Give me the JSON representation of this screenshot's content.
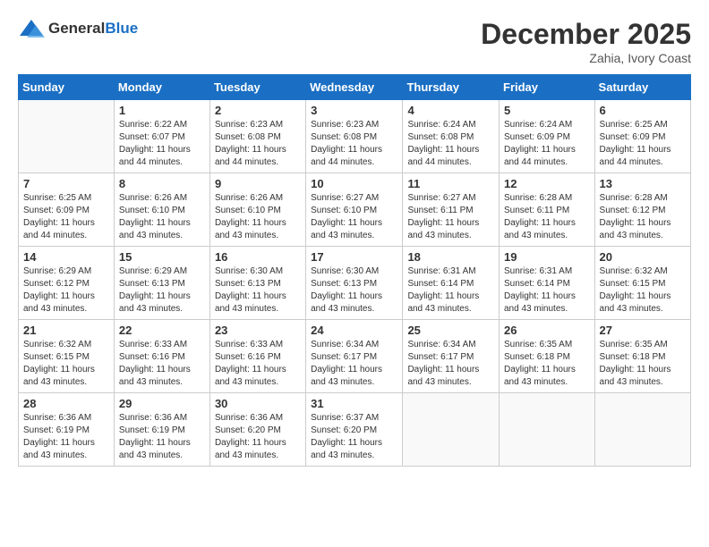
{
  "header": {
    "logo_general": "General",
    "logo_blue": "Blue",
    "month": "December 2025",
    "location": "Zahia, Ivory Coast"
  },
  "days_of_week": [
    "Sunday",
    "Monday",
    "Tuesday",
    "Wednesday",
    "Thursday",
    "Friday",
    "Saturday"
  ],
  "weeks": [
    [
      {
        "day": "",
        "sunrise": "",
        "sunset": "",
        "daylight": ""
      },
      {
        "day": "1",
        "sunrise": "Sunrise: 6:22 AM",
        "sunset": "Sunset: 6:07 PM",
        "daylight": "Daylight: 11 hours and 44 minutes."
      },
      {
        "day": "2",
        "sunrise": "Sunrise: 6:23 AM",
        "sunset": "Sunset: 6:08 PM",
        "daylight": "Daylight: 11 hours and 44 minutes."
      },
      {
        "day": "3",
        "sunrise": "Sunrise: 6:23 AM",
        "sunset": "Sunset: 6:08 PM",
        "daylight": "Daylight: 11 hours and 44 minutes."
      },
      {
        "day": "4",
        "sunrise": "Sunrise: 6:24 AM",
        "sunset": "Sunset: 6:08 PM",
        "daylight": "Daylight: 11 hours and 44 minutes."
      },
      {
        "day": "5",
        "sunrise": "Sunrise: 6:24 AM",
        "sunset": "Sunset: 6:09 PM",
        "daylight": "Daylight: 11 hours and 44 minutes."
      },
      {
        "day": "6",
        "sunrise": "Sunrise: 6:25 AM",
        "sunset": "Sunset: 6:09 PM",
        "daylight": "Daylight: 11 hours and 44 minutes."
      }
    ],
    [
      {
        "day": "7",
        "sunrise": "Sunrise: 6:25 AM",
        "sunset": "Sunset: 6:09 PM",
        "daylight": "Daylight: 11 hours and 44 minutes."
      },
      {
        "day": "8",
        "sunrise": "Sunrise: 6:26 AM",
        "sunset": "Sunset: 6:10 PM",
        "daylight": "Daylight: 11 hours and 43 minutes."
      },
      {
        "day": "9",
        "sunrise": "Sunrise: 6:26 AM",
        "sunset": "Sunset: 6:10 PM",
        "daylight": "Daylight: 11 hours and 43 minutes."
      },
      {
        "day": "10",
        "sunrise": "Sunrise: 6:27 AM",
        "sunset": "Sunset: 6:10 PM",
        "daylight": "Daylight: 11 hours and 43 minutes."
      },
      {
        "day": "11",
        "sunrise": "Sunrise: 6:27 AM",
        "sunset": "Sunset: 6:11 PM",
        "daylight": "Daylight: 11 hours and 43 minutes."
      },
      {
        "day": "12",
        "sunrise": "Sunrise: 6:28 AM",
        "sunset": "Sunset: 6:11 PM",
        "daylight": "Daylight: 11 hours and 43 minutes."
      },
      {
        "day": "13",
        "sunrise": "Sunrise: 6:28 AM",
        "sunset": "Sunset: 6:12 PM",
        "daylight": "Daylight: 11 hours and 43 minutes."
      }
    ],
    [
      {
        "day": "14",
        "sunrise": "Sunrise: 6:29 AM",
        "sunset": "Sunset: 6:12 PM",
        "daylight": "Daylight: 11 hours and 43 minutes."
      },
      {
        "day": "15",
        "sunrise": "Sunrise: 6:29 AM",
        "sunset": "Sunset: 6:13 PM",
        "daylight": "Daylight: 11 hours and 43 minutes."
      },
      {
        "day": "16",
        "sunrise": "Sunrise: 6:30 AM",
        "sunset": "Sunset: 6:13 PM",
        "daylight": "Daylight: 11 hours and 43 minutes."
      },
      {
        "day": "17",
        "sunrise": "Sunrise: 6:30 AM",
        "sunset": "Sunset: 6:13 PM",
        "daylight": "Daylight: 11 hours and 43 minutes."
      },
      {
        "day": "18",
        "sunrise": "Sunrise: 6:31 AM",
        "sunset": "Sunset: 6:14 PM",
        "daylight": "Daylight: 11 hours and 43 minutes."
      },
      {
        "day": "19",
        "sunrise": "Sunrise: 6:31 AM",
        "sunset": "Sunset: 6:14 PM",
        "daylight": "Daylight: 11 hours and 43 minutes."
      },
      {
        "day": "20",
        "sunrise": "Sunrise: 6:32 AM",
        "sunset": "Sunset: 6:15 PM",
        "daylight": "Daylight: 11 hours and 43 minutes."
      }
    ],
    [
      {
        "day": "21",
        "sunrise": "Sunrise: 6:32 AM",
        "sunset": "Sunset: 6:15 PM",
        "daylight": "Daylight: 11 hours and 43 minutes."
      },
      {
        "day": "22",
        "sunrise": "Sunrise: 6:33 AM",
        "sunset": "Sunset: 6:16 PM",
        "daylight": "Daylight: 11 hours and 43 minutes."
      },
      {
        "day": "23",
        "sunrise": "Sunrise: 6:33 AM",
        "sunset": "Sunset: 6:16 PM",
        "daylight": "Daylight: 11 hours and 43 minutes."
      },
      {
        "day": "24",
        "sunrise": "Sunrise: 6:34 AM",
        "sunset": "Sunset: 6:17 PM",
        "daylight": "Daylight: 11 hours and 43 minutes."
      },
      {
        "day": "25",
        "sunrise": "Sunrise: 6:34 AM",
        "sunset": "Sunset: 6:17 PM",
        "daylight": "Daylight: 11 hours and 43 minutes."
      },
      {
        "day": "26",
        "sunrise": "Sunrise: 6:35 AM",
        "sunset": "Sunset: 6:18 PM",
        "daylight": "Daylight: 11 hours and 43 minutes."
      },
      {
        "day": "27",
        "sunrise": "Sunrise: 6:35 AM",
        "sunset": "Sunset: 6:18 PM",
        "daylight": "Daylight: 11 hours and 43 minutes."
      }
    ],
    [
      {
        "day": "28",
        "sunrise": "Sunrise: 6:36 AM",
        "sunset": "Sunset: 6:19 PM",
        "daylight": "Daylight: 11 hours and 43 minutes."
      },
      {
        "day": "29",
        "sunrise": "Sunrise: 6:36 AM",
        "sunset": "Sunset: 6:19 PM",
        "daylight": "Daylight: 11 hours and 43 minutes."
      },
      {
        "day": "30",
        "sunrise": "Sunrise: 6:36 AM",
        "sunset": "Sunset: 6:20 PM",
        "daylight": "Daylight: 11 hours and 43 minutes."
      },
      {
        "day": "31",
        "sunrise": "Sunrise: 6:37 AM",
        "sunset": "Sunset: 6:20 PM",
        "daylight": "Daylight: 11 hours and 43 minutes."
      },
      {
        "day": "",
        "sunrise": "",
        "sunset": "",
        "daylight": ""
      },
      {
        "day": "",
        "sunrise": "",
        "sunset": "",
        "daylight": ""
      },
      {
        "day": "",
        "sunrise": "",
        "sunset": "",
        "daylight": ""
      }
    ]
  ]
}
